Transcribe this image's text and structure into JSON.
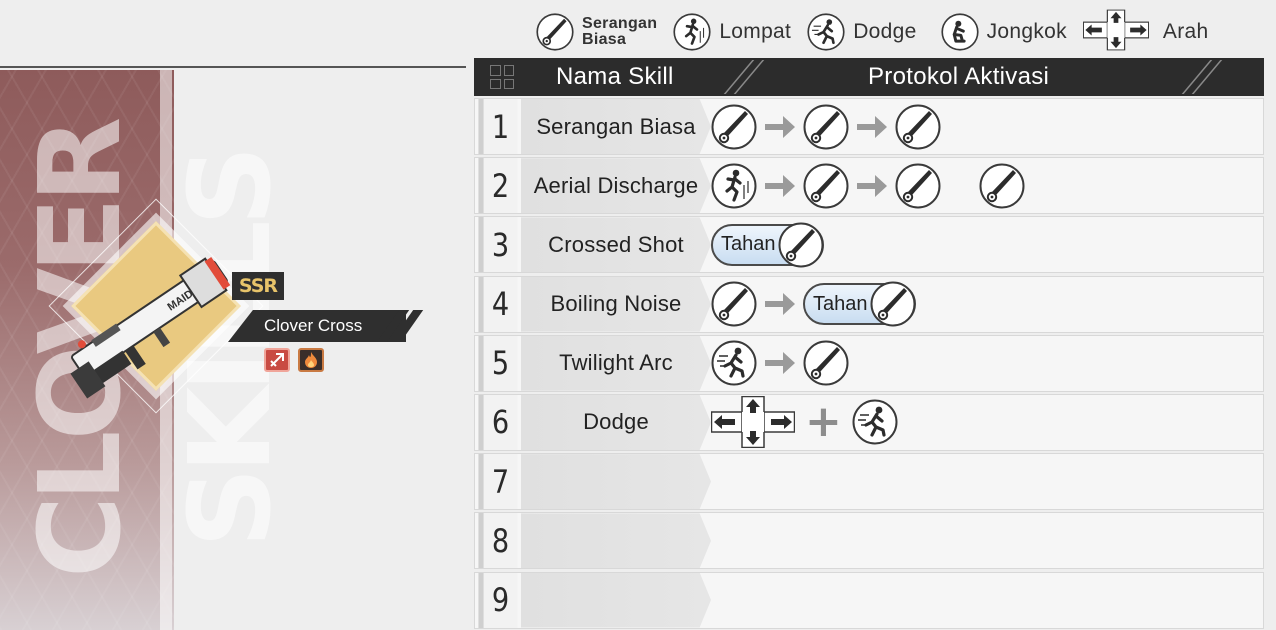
{
  "legend": [
    {
      "icon": "sword-icon",
      "label_line1": "Serangan",
      "label_line2": "Biasa"
    },
    {
      "icon": "jump-icon",
      "label": "Lompat"
    },
    {
      "icon": "dodge-icon",
      "label": "Dodge"
    },
    {
      "icon": "crouch-icon",
      "label": "Jongkok"
    },
    {
      "icon": "dpad-icon",
      "label": "Arah"
    }
  ],
  "weapon": {
    "banner_text": "CLOVER SKILLS",
    "art_text": "MAID",
    "rarity": "SSR",
    "name": "Clover Cross",
    "badges": [
      "skill-type-icon",
      "fire-element-icon"
    ],
    "colors": {
      "rarity_gold": "#e8c46a",
      "card_gold": "#e9c980",
      "banner": "#8e5b5b"
    }
  },
  "table": {
    "header_name": "Nama Skill",
    "header_protocol": "Protokol Aktivasi",
    "rows": [
      {
        "num": "1",
        "name": "Serangan Biasa",
        "seq": [
          "sword",
          "arrow",
          "sword",
          "arrow",
          "sword"
        ]
      },
      {
        "num": "2",
        "name": "Aerial Discharge",
        "seq": [
          "jump",
          "arrow",
          "sword",
          "arrow",
          "sword",
          "gap",
          "sword"
        ]
      },
      {
        "num": "3",
        "name": "Crossed Shot",
        "seq": [
          "hold"
        ]
      },
      {
        "num": "4",
        "name": "Boiling Noise",
        "seq": [
          "sword",
          "arrow",
          "hold"
        ]
      },
      {
        "num": "5",
        "name": "Twilight Arc",
        "seq": [
          "dodge",
          "arrow",
          "sword"
        ]
      },
      {
        "num": "6",
        "name": "Dodge",
        "seq": [
          "dpad",
          "plus",
          "dodge"
        ]
      },
      {
        "num": "7",
        "name": "",
        "seq": []
      },
      {
        "num": "8",
        "name": "",
        "seq": []
      },
      {
        "num": "9",
        "name": "",
        "seq": []
      }
    ],
    "hold_label": "Tahan",
    "plus_label": "+",
    "colors": {
      "header_bg": "#2c2c2c",
      "hold_fill": "#c9ddf1"
    }
  }
}
